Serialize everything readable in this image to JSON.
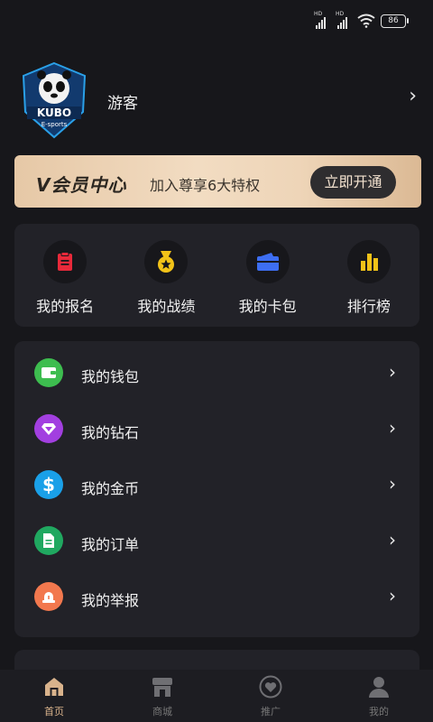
{
  "status_bar": {
    "signal1_label": "HD",
    "signal2_label": "HD",
    "battery": "86"
  },
  "profile": {
    "username": "游客",
    "logo_name": "KUBO",
    "logo_sub": "E-sports"
  },
  "vip": {
    "title": "V会员中心",
    "subtitle": "加入尊享6大特权",
    "button": "立即开通"
  },
  "shortcuts": [
    {
      "label": "我的报名",
      "icon": "clipboard-icon",
      "color": "#e8293a"
    },
    {
      "label": "我的战绩",
      "icon": "medal-icon",
      "color": "#f2c318"
    },
    {
      "label": "我的卡包",
      "icon": "card-wallet-icon",
      "color": "#3d6ef2"
    },
    {
      "label": "排行榜",
      "icon": "bar-chart-icon",
      "color": "#f2c318"
    }
  ],
  "menu": [
    {
      "label": "我的钱包",
      "icon": "wallet-icon",
      "color": "#3dbd4f"
    },
    {
      "label": "我的钻石",
      "icon": "diamond-icon",
      "color": "#a23fe0"
    },
    {
      "label": "我的金币",
      "icon": "dollar-coin-icon",
      "color": "#1aa0e8"
    },
    {
      "label": "我的订单",
      "icon": "order-doc-icon",
      "color": "#20a860"
    },
    {
      "label": "我的举报",
      "icon": "alarm-icon",
      "color": "#f2784e"
    }
  ],
  "bottom_nav": [
    {
      "label": "首页",
      "icon": "home-icon",
      "active": true
    },
    {
      "label": "商城",
      "icon": "shop-icon",
      "active": false
    },
    {
      "label": "推广",
      "icon": "heart-icon",
      "active": false
    },
    {
      "label": "我的",
      "icon": "user-icon",
      "active": false
    }
  ],
  "colors": {
    "background": "#17171b",
    "card": "#222228",
    "accent_gold": "#d9b38c"
  }
}
